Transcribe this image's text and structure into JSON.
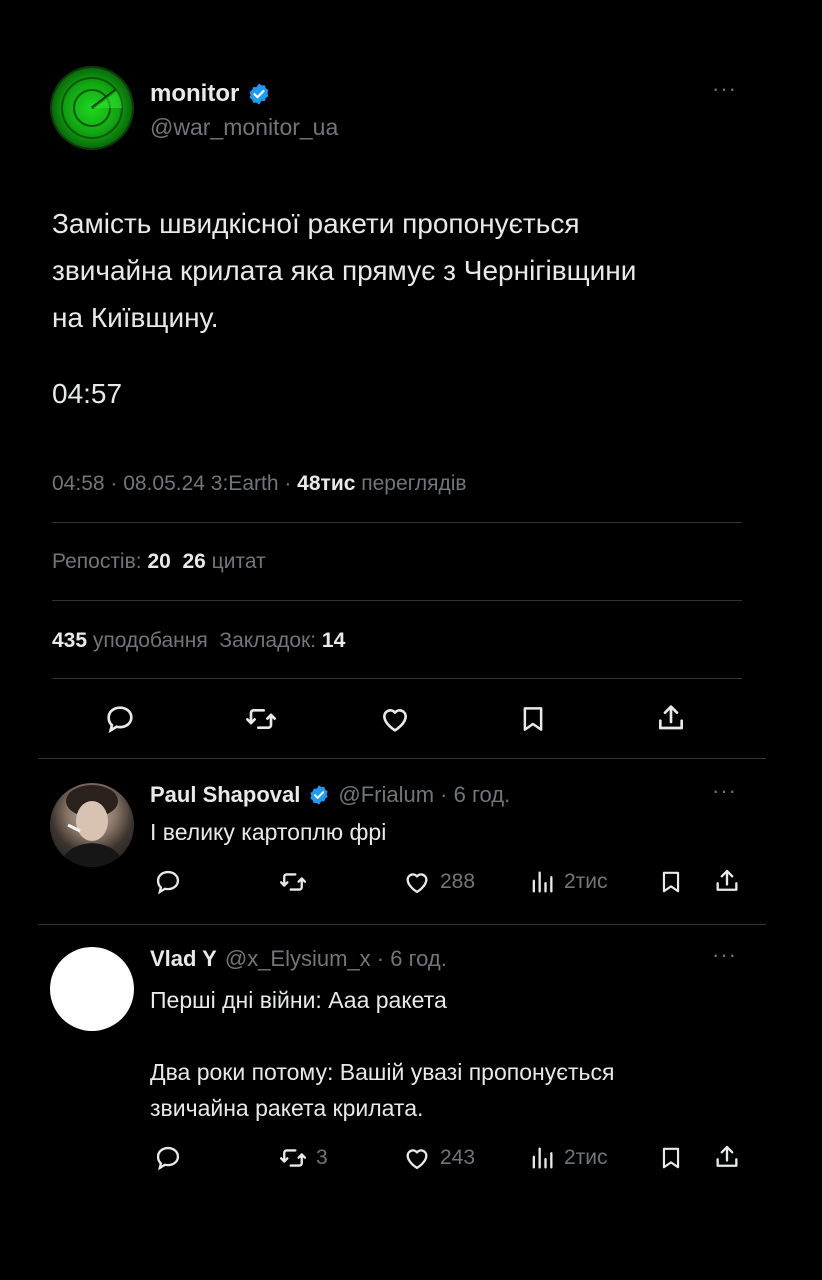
{
  "post": {
    "display_name": "monitor",
    "handle": "@war_monitor_ua",
    "text_lines": [
      "Замість швидкісної ракети пропонується",
      "звичайна крилата яка прямує з Чернігівщини",
      "на Київщину."
    ],
    "time_in_text": "04:57",
    "meta_time_date": "04:58 · 08.05.24 3:Earth ·",
    "views_count": "48тис",
    "views_label": "переглядів",
    "reposts_label": "Репостів:",
    "reposts_count": "20",
    "quotes_count": "26",
    "quotes_label": "цитат",
    "likes_count": "435",
    "likes_label": "уподобання",
    "bookmarks_label": "Закладок:",
    "bookmarks_count": "14"
  },
  "replies": [
    {
      "display_name": "Paul Shapoval",
      "handle_time": "@Frialum · 6 год.",
      "text_lines": [
        "І велику картоплю фрі"
      ],
      "reposts": "",
      "likes": "288",
      "views": "2тис"
    },
    {
      "display_name": "Vlad Y",
      "handle_time": "@x_Elysium_x · 6 год.",
      "text_lines": [
        "Перші дні війни: Ааа ракета",
        "",
        "Два роки потому: Вашій увазі пропонується",
        "звичайна ракета крилата."
      ],
      "reposts": "3",
      "likes": "243",
      "views": "2тис"
    }
  ],
  "colors": {
    "background": "#000000",
    "text": "#e7e9ea",
    "muted": "#71767b",
    "verified": "#1d9bf0",
    "divider": "#2f3336"
  },
  "icons": [
    "verified-badge-icon",
    "more-dots-icon",
    "reply-icon",
    "repost-icon",
    "like-icon",
    "bookmark-icon",
    "share-icon",
    "views-icon"
  ]
}
